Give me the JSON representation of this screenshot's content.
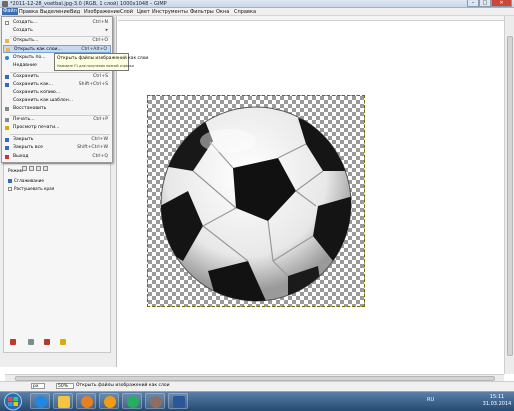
{
  "window": {
    "title": "*2011-12-28_voetbal.jpg-3.0 (RGB, 1 слой) 1000x1048 – GIMP",
    "controls": {
      "minimize": "–",
      "maximize": "□",
      "close": "✕"
    }
  },
  "menubar": [
    {
      "label": "Файл",
      "active": true
    },
    {
      "label": "Правка"
    },
    {
      "label": "Выделение"
    },
    {
      "label": "Вид"
    },
    {
      "label": "Изображение"
    },
    {
      "label": "Слой"
    },
    {
      "label": "Цвет"
    },
    {
      "label": "Инструменты"
    },
    {
      "label": "Фильтры"
    },
    {
      "label": "Окна"
    },
    {
      "label": "Справка"
    }
  ],
  "file_menu": [
    {
      "label": "Создать...",
      "shortcut": "Ctrl+N",
      "icon": "new-icon"
    },
    {
      "label": "Создать",
      "shortcut": "▸",
      "icon": ""
    },
    {
      "label": "Открыть...",
      "shortcut": "Ctrl+O",
      "icon": "open-icon"
    },
    {
      "label": "Открыть как слои...",
      "shortcut": "Ctrl+Alt+O",
      "icon": "open-layers-icon",
      "hover": true
    },
    {
      "label": "Открыть по...",
      "shortcut": "",
      "icon": "globe-icon"
    },
    {
      "label": "Недавние",
      "shortcut": "",
      "icon": ""
    },
    {
      "label": "Сохранить",
      "shortcut": "Ctrl+S",
      "icon": "save-icon"
    },
    {
      "label": "Сохранить как...",
      "shortcut": "Shift+Ctrl+S",
      "icon": "save-as-icon"
    },
    {
      "label": "Сохранить копию...",
      "shortcut": "",
      "icon": ""
    },
    {
      "label": "Сохранить как шаблон...",
      "shortcut": "",
      "icon": ""
    },
    {
      "label": "Восстановить",
      "shortcut": "",
      "icon": "revert-icon"
    },
    {
      "label": "Печать...",
      "shortcut": "Ctrl+P",
      "icon": "print-icon"
    },
    {
      "label": "Просмотр печати...",
      "shortcut": "",
      "icon": "print-preview-icon"
    },
    {
      "label": "Закрыть",
      "shortcut": "Ctrl+W",
      "icon": "close-doc-icon"
    },
    {
      "label": "Закрыть все",
      "shortcut": "Shift+Ctrl+W",
      "icon": "close-all-icon"
    },
    {
      "label": "Выход",
      "shortcut": "Ctrl+Q",
      "icon": "quit-icon"
    }
  ],
  "tooltip": {
    "title": "Открыть файлы изображений как слои",
    "hint": "Нажмите F1 для получения полной справки"
  },
  "tool_options": {
    "mode_label": "Режим",
    "antialias_label": "Сглаживание",
    "feather_label": "Растушевать края"
  },
  "statusbar": {
    "unit": "px",
    "zoom": "50%",
    "message": "Открыть файлы изображений как слои"
  },
  "taskbar": {
    "apps": [
      "ie-icon",
      "explorer-icon",
      "media-icon",
      "firefox-icon",
      "chrome-icon",
      "gimp-icon",
      "word-icon"
    ],
    "lang": "RU",
    "time": "15:11",
    "date": "31.03.2014"
  },
  "colors": {
    "menu_highlight": "#3b6fb0",
    "item_hover": "#c6d9f0",
    "tooltip_bg": "#ffffe1",
    "taskbar": "#254a72"
  }
}
